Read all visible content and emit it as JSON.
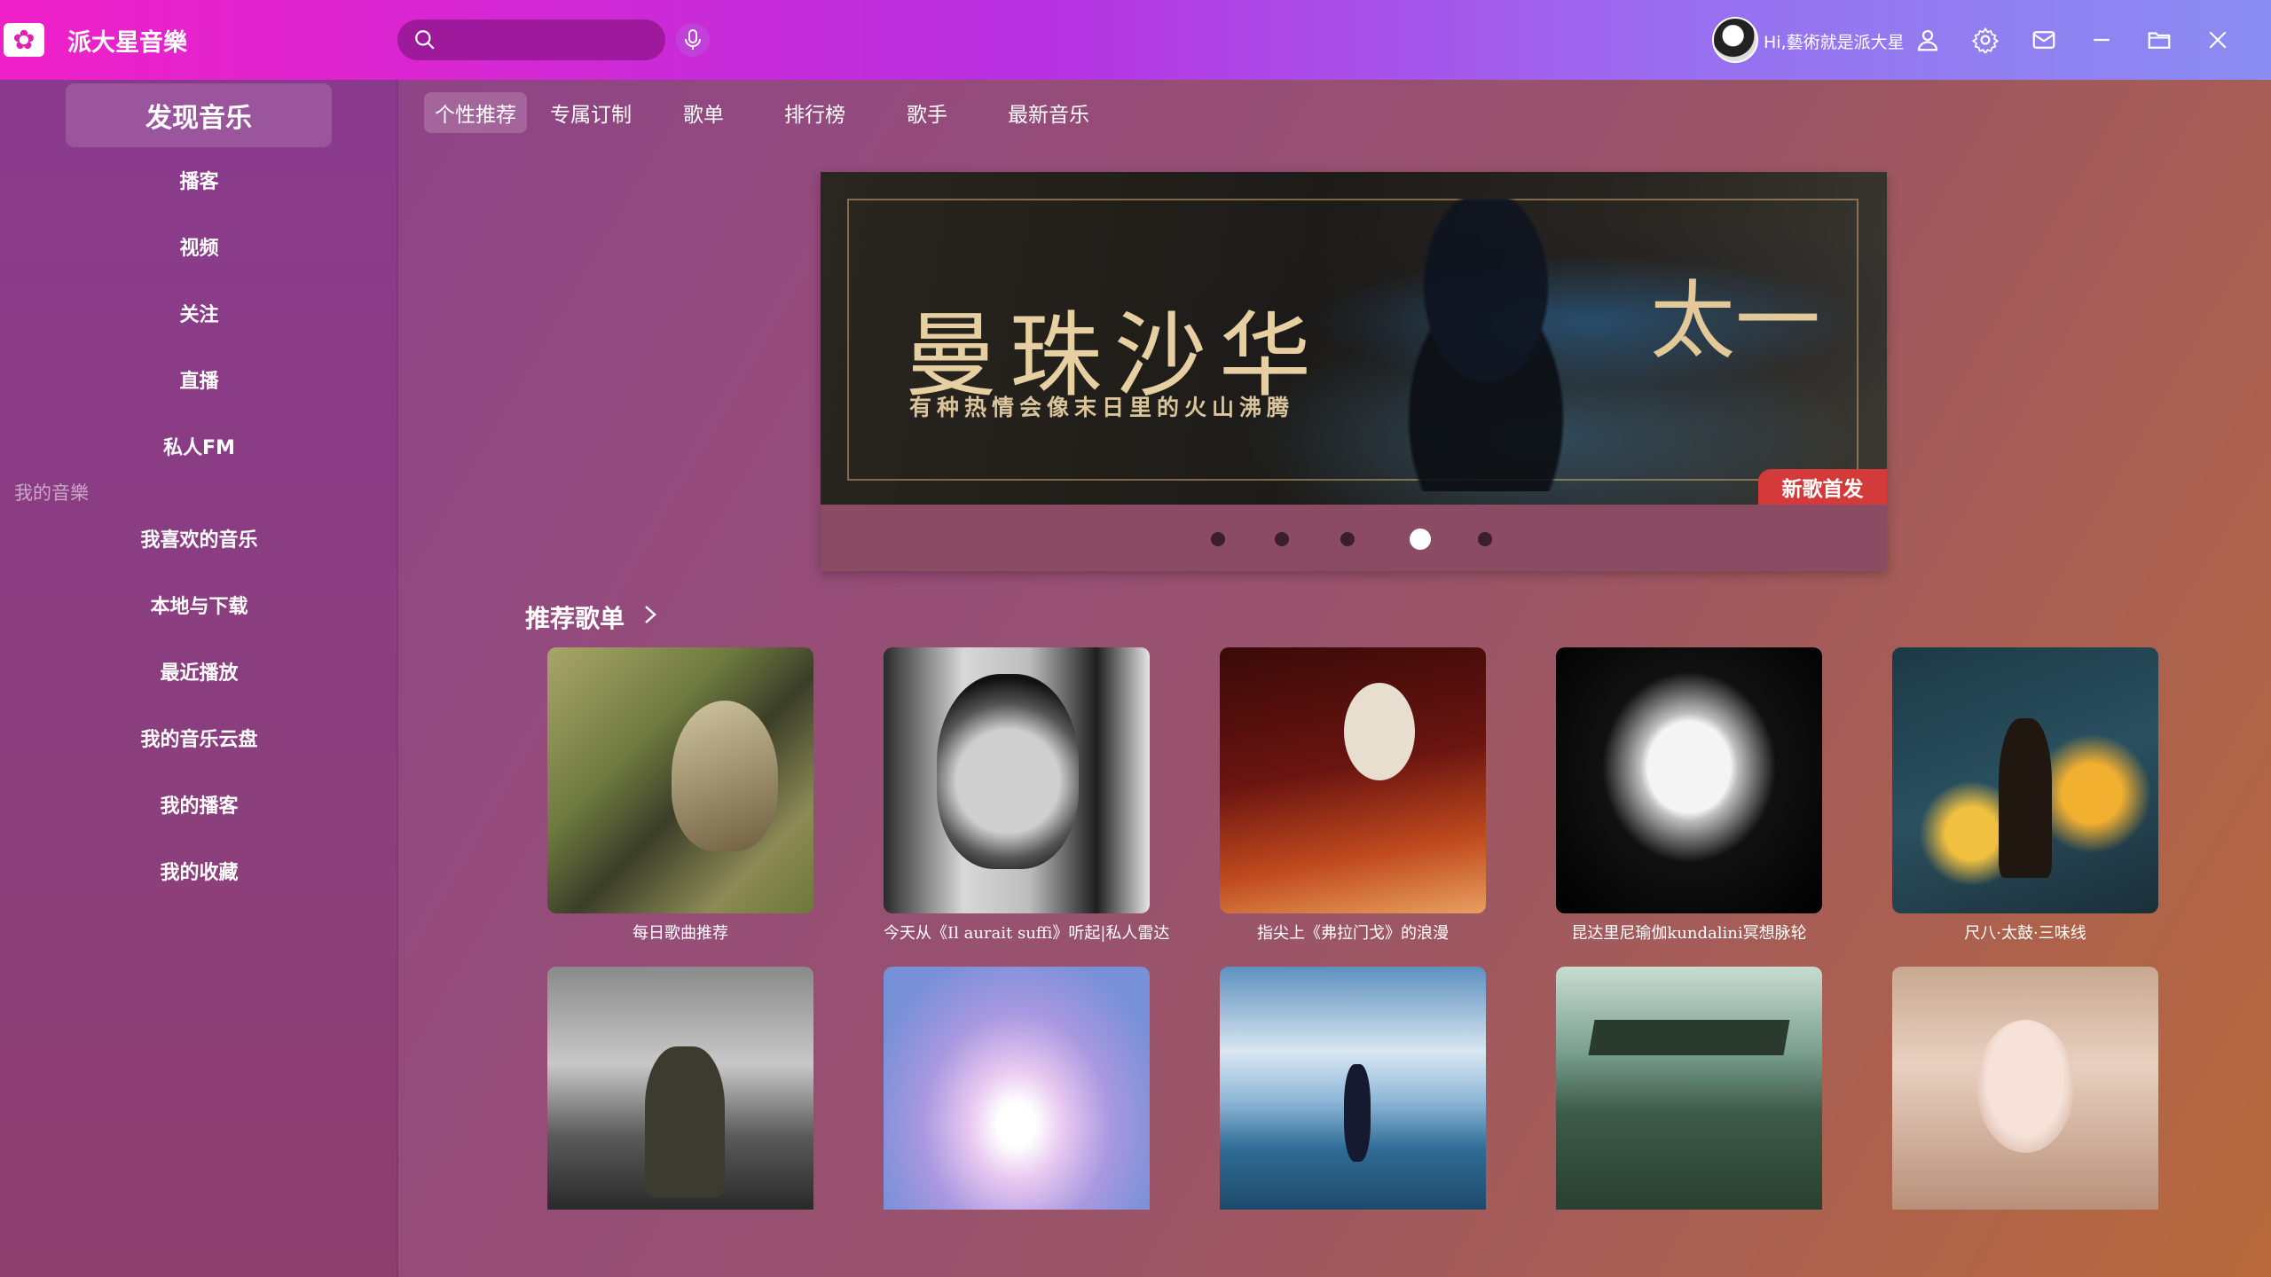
{
  "app": {
    "title": "派大星音樂",
    "logo_glyph": "✿"
  },
  "search": {
    "placeholder": "",
    "value": ""
  },
  "user": {
    "name": "Hi,藝術就是派大星"
  },
  "sidebar": {
    "discover": "发现音乐",
    "items": [
      {
        "label": "播客"
      },
      {
        "label": "视频"
      },
      {
        "label": "关注"
      },
      {
        "label": "直播"
      },
      {
        "label": "私人FM"
      }
    ],
    "my_music_label": "我的音樂",
    "my_items": [
      {
        "label": "我喜欢的音乐"
      },
      {
        "label": "本地与下载"
      },
      {
        "label": "最近播放"
      },
      {
        "label": "我的音乐云盘"
      },
      {
        "label": "我的播客"
      },
      {
        "label": "我的收藏"
      }
    ]
  },
  "tabs": [
    {
      "label": "个性推荐",
      "active": true
    },
    {
      "label": "专属订制"
    },
    {
      "label": "歌单"
    },
    {
      "label": "排行榜"
    },
    {
      "label": "歌手"
    },
    {
      "label": "最新音乐"
    }
  ],
  "banner": {
    "title": "曼珠沙华",
    "subtitle": "有种热情会像末日里的火山沸腾",
    "side_text": "太一",
    "tag": "新歌首发",
    "active_dot": 3,
    "dot_count": 5
  },
  "playlists": {
    "title": "推荐歌单",
    "row1": [
      {
        "label": "每日歌曲推荐"
      },
      {
        "label": "今天从《Il aurait suffi》听起|私人雷达"
      },
      {
        "label": "指尖上《弗拉门戈》的浪漫"
      },
      {
        "label": "昆达里尼瑜伽kundalini冥想脉轮"
      },
      {
        "label": "尺八·太鼓·三味线"
      }
    ],
    "row2_count": 5
  },
  "colors": {
    "accent": "#f020c8",
    "tag_red": "#d43a3a"
  }
}
